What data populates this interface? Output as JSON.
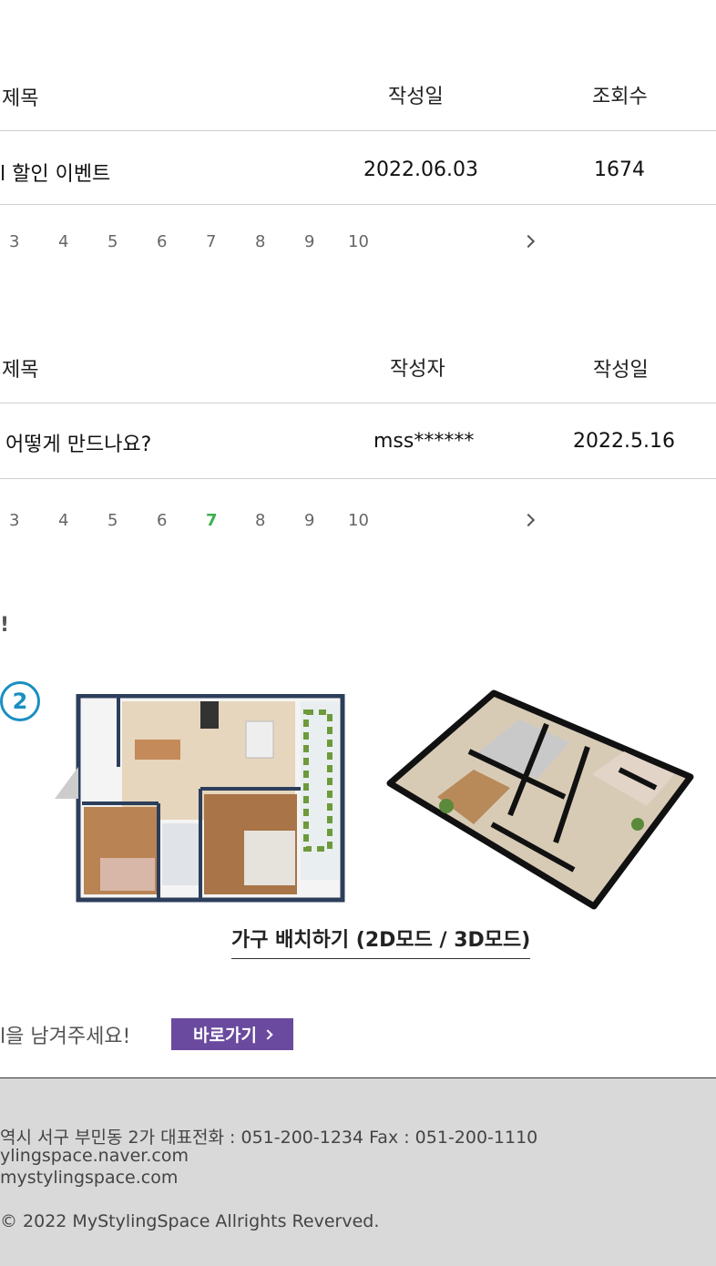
{
  "notice_board": {
    "headers": {
      "title": "제목",
      "date": "작성일",
      "views": "조회수"
    },
    "row": {
      "title": "l 할인 이벤트",
      "date": "2022.06.03",
      "views": "1674"
    },
    "pages": [
      "3",
      "4",
      "5",
      "6",
      "7",
      "8",
      "9",
      "10"
    ],
    "active_page": ""
  },
  "qna_board": {
    "headers": {
      "title": "제목",
      "author": "작성자",
      "date": "작성일"
    },
    "row": {
      "title": "어떻게 만드나요?",
      "author": "mss******",
      "date": "2022.5.16"
    },
    "pages": [
      "3",
      "4",
      "5",
      "6",
      "7",
      "8",
      "9",
      "10"
    ],
    "active_page": "7"
  },
  "section": {
    "exclaim": "!",
    "step_number": "2",
    "furniture_link": "가구 배치하기 (2D모드 / 3D모드)"
  },
  "cta": {
    "text": "l을 남겨주세요!",
    "button": "바로가기"
  },
  "footer": {
    "address": "역시 서구 부민동 2가  대표전화 : 051-200-1234 Fax : 051-200-1110",
    "blog": "ylingspace.naver.com",
    "site": "mystylingspace.com",
    "copyright": "© 2022 MyStylingSpace Allrights Reverved."
  },
  "colors": {
    "accent_green": "#3daf4e",
    "badge_blue": "#1a8fc1",
    "button_purple": "#6a4a9e",
    "footer_bg": "#d9d9d9"
  }
}
